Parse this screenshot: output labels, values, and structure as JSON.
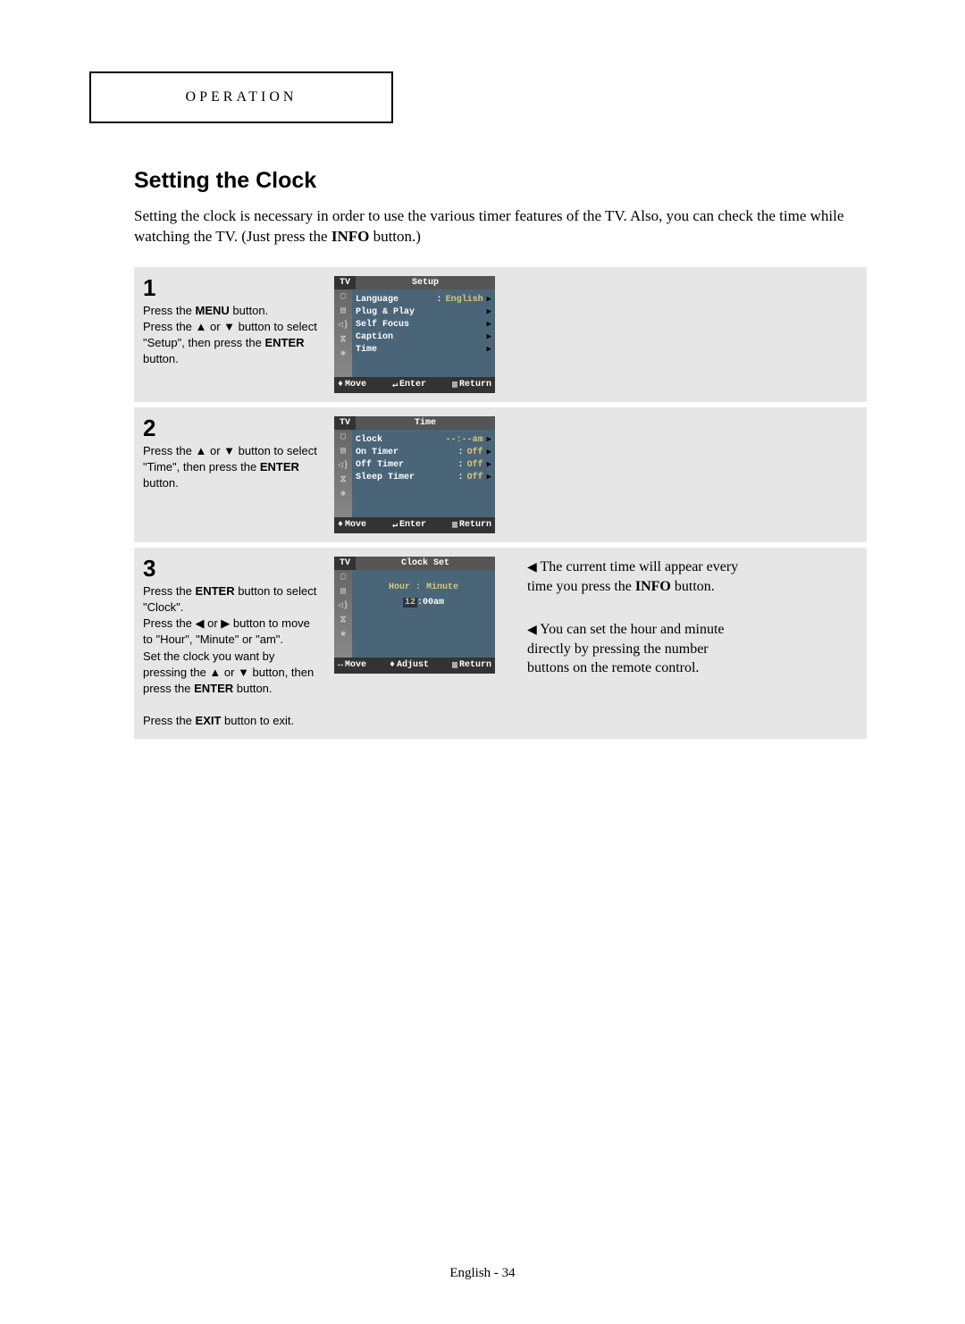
{
  "header": "OPERATION",
  "section_title": "Setting the Clock",
  "section_intro_1": "Setting the clock is necessary in order to use the various timer features of the TV. Also, you can check the time while watching the TV. (Just press the ",
  "section_intro_bold": "INFO",
  "section_intro_2": " button.)",
  "steps": {
    "s1": {
      "num": "1",
      "text_parts": {
        "t1": "Press the ",
        "b1": "MENU",
        "t2": " button.",
        "t3": "Press the ▲ or ▼ button to select \"Setup\", then press the ",
        "b2": "ENTER",
        "t4": " button."
      },
      "osd": {
        "tv": "TV",
        "title": "Setup",
        "rows": [
          {
            "label": "Language",
            "colon": ":",
            "val": "English",
            "arrow": "▶"
          },
          {
            "label": "Plug & Play",
            "colon": "",
            "val": "",
            "arrow": "▶"
          },
          {
            "label": "Self Focus",
            "colon": "",
            "val": "",
            "arrow": "▶"
          },
          {
            "label": "Caption",
            "colon": "",
            "val": "",
            "arrow": "▶"
          },
          {
            "label": "Time",
            "colon": "",
            "val": "",
            "arrow": "▶"
          }
        ],
        "foot": {
          "h1s": "♦",
          "h1": "Move",
          "h2s": "↵",
          "h2": "Enter",
          "h3s": "▥",
          "h3": "Return"
        }
      }
    },
    "s2": {
      "num": "2",
      "text_parts": {
        "t1": "Press the ▲ or ▼ button to select \"Time\", then press the ",
        "b1": "ENTER",
        "t2": " button."
      },
      "osd": {
        "tv": "TV",
        "title": "Time",
        "rows": [
          {
            "label": "Clock",
            "colon": "",
            "val": "--:--am",
            "arrow": "▶"
          },
          {
            "label": "On Timer",
            "colon": ":",
            "val": "Off",
            "arrow": "▶"
          },
          {
            "label": "Off Timer",
            "colon": ":",
            "val": "Off",
            "arrow": "▶"
          },
          {
            "label": "Sleep Timer",
            "colon": ":",
            "val": "Off",
            "arrow": "▶"
          }
        ],
        "foot": {
          "h1s": "♦",
          "h1": "Move",
          "h2s": "↵",
          "h2": "Enter",
          "h3s": "▥",
          "h3": "Return"
        }
      }
    },
    "s3": {
      "num": "3",
      "text_parts": {
        "t1": "Press the ",
        "b1": "ENTER",
        "t2": " button to select \"Clock\".",
        "t3": "Press the ◀ or ▶ button to move to \"Hour\", \"Minute\" or \"am\".",
        "t4": "Set the clock you want by pressing the ▲ or ▼ button, then press the ",
        "b2": "ENTER",
        "t5": " button.",
        "t6": "Press the ",
        "b3": "EXIT",
        "t7": " button to exit."
      },
      "osd": {
        "tv": "TV",
        "title": "Clock Set",
        "hm_label": "Hour : Minute",
        "time_hl": "12",
        "time_rest": ":00am",
        "foot": {
          "h1s": "↔",
          "h1": "Move",
          "h2s": "♦",
          "h2": "Adjust",
          "h3s": "▥",
          "h3": "Return"
        }
      }
    }
  },
  "notes": {
    "n1": {
      "arrow": "◀",
      "t1": " The current time will appear every time you press the ",
      "b": "INFO",
      "t2": " button."
    },
    "n2": {
      "arrow": "◀",
      "t1": " You can set the hour and minute directly by pressing the number buttons on the remote control."
    }
  },
  "footer": "English - 34"
}
